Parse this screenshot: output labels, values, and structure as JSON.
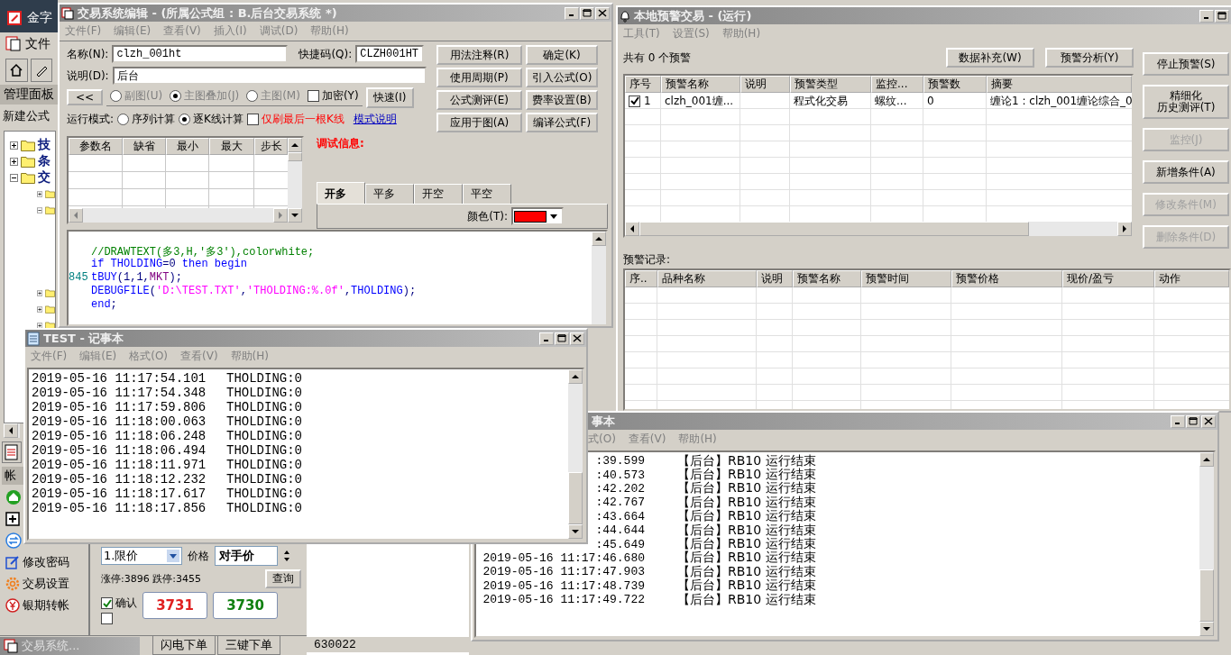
{
  "main_app": {
    "title": "金字",
    "menu": [
      "文件"
    ],
    "panel_title": "管理面板",
    "new_formula": "新建公式",
    "tree": [
      {
        "label": "技",
        "expanded": false
      },
      {
        "label": "条",
        "expanded": false
      },
      {
        "label": "交",
        "expanded": true,
        "children": [
          {
            "expanded": false
          },
          {
            "expanded": true
          },
          {
            "expanded": false
          },
          {
            "expanded": false
          },
          {
            "expanded": false
          }
        ]
      }
    ]
  },
  "editor": {
    "title": "交易系统编辑 - (所属公式组 : B.后台交易系统 *)",
    "menu": [
      "文件(F)",
      "编辑(E)",
      "查看(V)",
      "插入(I)",
      "调试(D)",
      "帮助(H)"
    ],
    "name_label": "名称(N):",
    "name_value": "clzh_001ht",
    "shortcut_label": "快捷码(Q):",
    "shortcut_value": "CLZH001HT",
    "desc_label": "说明(D):",
    "desc_value": "后台",
    "buttons": [
      "用法注释(R)",
      "确定(K)",
      "使用周期(P)",
      "引入公式(O)",
      "公式测评(E)",
      "费率设置(B)",
      "应用于图(A)",
      "编译公式(F)"
    ],
    "collapse_button": "<<",
    "chart_radios": [
      {
        "label": "副图(U)",
        "selected": false
      },
      {
        "label": "主图叠加(J)",
        "selected": true
      },
      {
        "label": "主图(M)",
        "selected": false
      }
    ],
    "encrypt": {
      "label": "加密(Y)",
      "checked": false
    },
    "fast_button": "快速(I)",
    "run_mode_label": "运行模式:",
    "run_modes": [
      {
        "label": "序列计算",
        "selected": false
      },
      {
        "label": "逐K线计算",
        "selected": true
      }
    ],
    "last_bar_only": {
      "label": "仅刷最后一根K线",
      "checked": false
    },
    "mode_help_link": "模式说明",
    "param_columns": [
      "参数名",
      "缺省",
      "最小",
      "最大",
      "步长"
    ],
    "debug_label": "调试信息:",
    "signal_tabs": [
      {
        "label": "开多",
        "selected": true
      },
      {
        "label": "平多",
        "selected": false
      },
      {
        "label": "开空",
        "selected": false
      },
      {
        "label": "平空",
        "selected": false
      }
    ],
    "color_label": "颜色(T):",
    "color": "#ff0000",
    "code": [
      {
        "tokens": [
          {
            "kind": "comment",
            "text": "//DRAWTEXT(多3,H,'多3'),colorwhite;"
          }
        ]
      },
      {
        "tokens": [
          {
            "kind": "keyword",
            "text": "if THOLDING"
          },
          {
            "kind": "plain",
            "text": "=0 "
          },
          {
            "kind": "keyword",
            "text": "then begin"
          }
        ]
      },
      {
        "number": "845",
        "tokens": [
          {
            "kind": "keyword",
            "text": "tBUY"
          },
          {
            "kind": "plain",
            "text": "(1,1,"
          },
          {
            "kind": "constant",
            "text": "MKT"
          },
          {
            "kind": "plain",
            "text": ");"
          }
        ]
      },
      {
        "tokens": [
          {
            "kind": "keyword",
            "text": "DEBUGFILE"
          },
          {
            "kind": "plain",
            "text": "("
          },
          {
            "kind": "string",
            "text": "'D:\\TEST.TXT'"
          },
          {
            "kind": "plain",
            "text": ","
          },
          {
            "kind": "string",
            "text": "'THOLDING:%.0f'"
          },
          {
            "kind": "plain",
            "text": ","
          },
          {
            "kind": "keyword",
            "text": "THOLDING"
          },
          {
            "kind": "plain",
            "text": ");"
          }
        ]
      },
      {
        "tokens": [
          {
            "kind": "keyword",
            "text": "end"
          },
          {
            "kind": "plain",
            "text": ";"
          }
        ]
      }
    ]
  },
  "alert": {
    "title": "本地预警交易 - (运行)",
    "menu": [
      "工具(T)",
      "设置(S)",
      "帮助(H)"
    ],
    "count": "共有 0 个预警",
    "top_buttons": [
      "数据补充(W)",
      "预警分析(Y)"
    ],
    "side_buttons": [
      {
        "label": "停止预警(S)",
        "disabled": false
      },
      {
        "lines": [
          "精细化",
          "历史测评(T)"
        ],
        "disabled": false
      },
      {
        "label": "监控(J)",
        "disabled": true
      },
      {
        "label": "新增条件(A)",
        "disabled": false
      },
      {
        "label": "修改条件(M)",
        "disabled": true
      },
      {
        "label": "删除条件(D)",
        "disabled": true
      }
    ],
    "columns": [
      "序号",
      "预警名称",
      "说明",
      "预警类型",
      "监控...",
      "预警数",
      "摘要"
    ],
    "rows": [
      {
        "checked": true,
        "cells": [
          "1",
          "clzh_001缠...",
          "",
          "程式化交易",
          "螺纹...",
          "0",
          "缠论1 : clzh_001缠论综合_0"
        ]
      }
    ],
    "records_label": "预警记录:",
    "record_columns": [
      "序..",
      "品种名称",
      "说明",
      "预警名称",
      "预警时间",
      "预警价格",
      "现价/盈亏",
      "动作"
    ]
  },
  "test_notepad": {
    "title": "TEST - 记事本",
    "menu": [
      "文件(F)",
      "编辑(E)",
      "格式(O)",
      "查看(V)",
      "帮助(H)"
    ],
    "lines": [
      {
        "time": "2019-05-16 11:17:54.101",
        "text": "THOLDING:0"
      },
      {
        "time": "2019-05-16 11:17:54.348",
        "text": "THOLDING:0"
      },
      {
        "time": "2019-05-16 11:17:59.806",
        "text": "THOLDING:0"
      },
      {
        "time": "2019-05-16 11:18:00.063",
        "text": "THOLDING:0"
      },
      {
        "time": "2019-05-16 11:18:06.248",
        "text": "THOLDING:0"
      },
      {
        "time": "2019-05-16 11:18:06.494",
        "text": "THOLDING:0"
      },
      {
        "time": "2019-05-16 11:18:11.971",
        "text": "THOLDING:0"
      },
      {
        "time": "2019-05-16 11:18:12.232",
        "text": "THOLDING:0"
      },
      {
        "time": "2019-05-16 11:18:17.617",
        "text": "THOLDING:0"
      },
      {
        "time": "2019-05-16 11:18:17.856",
        "text": "THOLDING:0"
      }
    ]
  },
  "log_notepad": {
    "title": "事本",
    "menu": [
      "式(O)",
      "查看(V)",
      "帮助(H)"
    ],
    "lines": [
      {
        "time": ":39.599",
        "text": "【后台】RB10 运行结束"
      },
      {
        "time": ":40.573",
        "text": "【后台】RB10 运行结束"
      },
      {
        "time": ":42.202",
        "text": "【后台】RB10 运行结束"
      },
      {
        "time": ":42.767",
        "text": "【后台】RB10 运行结束"
      },
      {
        "time": ":43.664",
        "text": "【后台】RB10 运行结束"
      },
      {
        "time": ":44.644",
        "text": "【后台】RB10 运行结束"
      },
      {
        "time": ":45.649",
        "text": "【后台】RB10 运行结束"
      },
      {
        "time": "2019-05-16 11:17:46.680",
        "text": "【后台】RB10 运行结束"
      },
      {
        "time": "2019-05-16 11:17:47.903",
        "text": "【后台】RB10 运行结束"
      },
      {
        "time": "2019-05-16 11:17:48.739",
        "text": "【后台】RB10 运行结束"
      },
      {
        "time": "2019-05-16 11:17:49.722",
        "text": "【后台】RB10 运行结束"
      }
    ]
  },
  "account_panel": {
    "tab_label": "帐",
    "actions": [
      {
        "kind": "home"
      },
      {
        "kind": "add"
      },
      {
        "kind": "transfer"
      },
      {
        "kind": "password",
        "label": "修改密码"
      },
      {
        "kind": "settings",
        "label": "交易设置"
      },
      {
        "kind": "bank",
        "label": "银期转帐"
      }
    ]
  },
  "order_panel": {
    "order_type": "1.限价",
    "price_label": "价格",
    "price_value": "对手价",
    "limits": "涨停:3896 跌停:3455",
    "query_button": "查询",
    "confirm": {
      "label": "确认",
      "checked": true
    },
    "hedge": {
      "checked": false
    },
    "buy_price": "3731",
    "sell_price": "3730",
    "tabs": [
      {
        "label": "闪电下单",
        "selected": false
      },
      {
        "label": "三键下单",
        "selected": false
      }
    ],
    "code": "630022"
  },
  "minimized_window": {
    "title": "交易系统..."
  }
}
